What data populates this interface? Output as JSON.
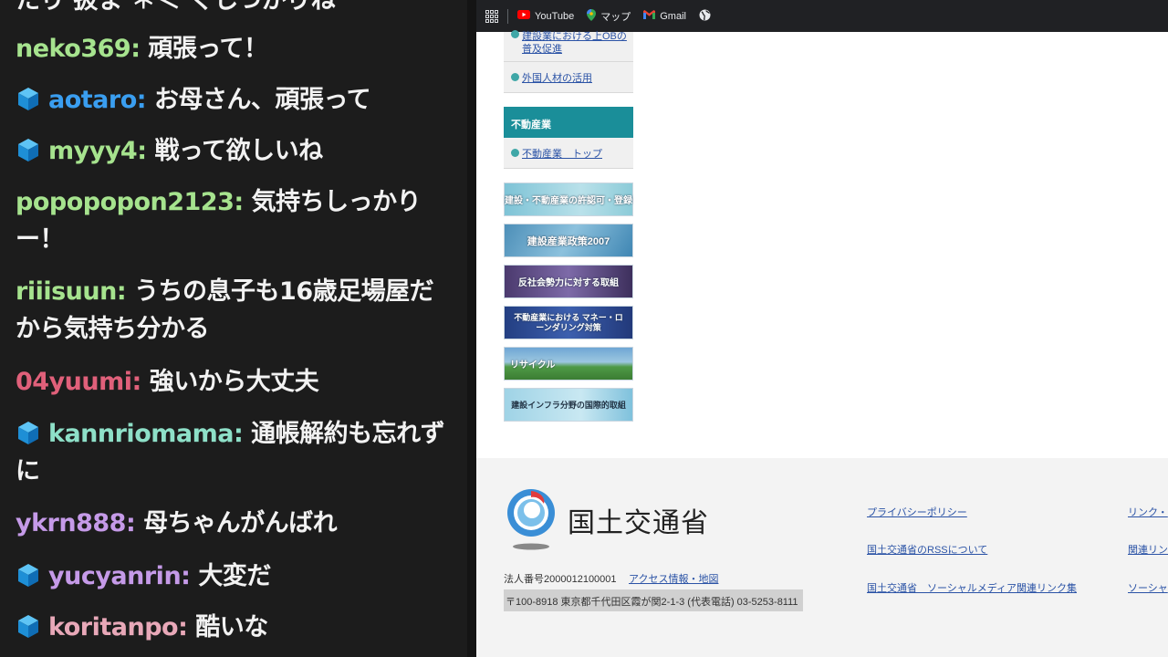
{
  "chat": {
    "top_cut": "たり 扱ま ＊＜ くしつかりね",
    "messages": [
      {
        "user": "neko369",
        "text": "頑張って！",
        "color": "#a6e38e",
        "badge": false
      },
      {
        "user": "aotaro",
        "text": "お母さん、頑張って",
        "color": "#3a9ef0",
        "badge": true
      },
      {
        "user": "myyy4",
        "text": "戦って欲しいね",
        "color": "#a6e38e",
        "badge": true
      },
      {
        "user": "popopopon2123",
        "text": "気持ちしっかりー！",
        "color": "#a6e38e",
        "badge": false
      },
      {
        "user": "riiisuun",
        "text": "うちの息子も16歳足場屋だから気持ち分かる",
        "color": "#a6e38e",
        "badge": false
      },
      {
        "user": "04yuumi",
        "text": "強いから大丈夫",
        "color": "#e0607a",
        "badge": false
      },
      {
        "user": "kannriomama",
        "text": "通帳解約も忘れずに",
        "color": "#8ee0c8",
        "badge": true
      },
      {
        "user": "ykrn888",
        "text": "母ちゃんがんばれ",
        "color": "#c59ae8",
        "badge": false
      },
      {
        "user": "yucyanrin",
        "text": "大変だ",
        "color": "#c59ae8",
        "badge": true
      },
      {
        "user": "koritanpo",
        "text": "酷いな",
        "color": "#e8a8b8",
        "badge": true
      }
    ]
  },
  "browser": {
    "bookmarks": {
      "youtube": "YouTube",
      "maps": "マップ",
      "gmail": "Gmail"
    },
    "sidebar": {
      "link_cut_line1": "建設業における上OBの",
      "link_cut_line2": "普及促進",
      "link_foreign": "外国人材の活用",
      "category_title": "不動産業",
      "link_realestate_top": "不動産業　トップ",
      "banners": [
        "建設・不動産業の許認可・登録",
        "建設産業政策2007",
        "反社会勢力に対する取組",
        "不動産業における マネー・ローンダリング対策",
        "リサイクル",
        "建設インフラ分野の国際的取組"
      ]
    },
    "footer": {
      "org_name": "国土交通省",
      "corp_number": "法人番号2000012100001",
      "access_link": "アクセス情報・地図",
      "address": "〒100-8918 東京都千代田区霞が関2-1-3 (代表電話) 03-5253-8111",
      "links_col1": [
        "プライバシーポリシー",
        "国土交通省のRSSについて",
        "国土交通省　ソーシャルメディア関連リンク集"
      ],
      "links_col2": [
        "リンク・",
        "関連リン",
        "ソーシャ"
      ]
    }
  }
}
